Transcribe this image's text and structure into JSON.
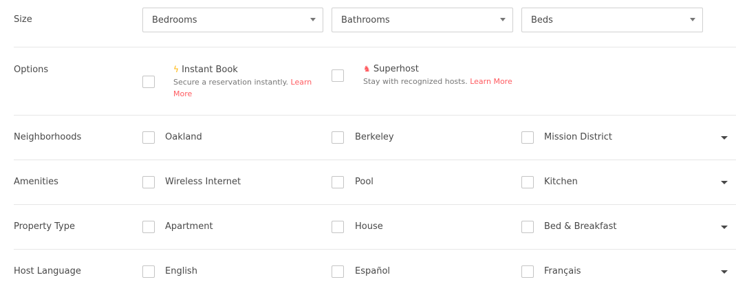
{
  "size": {
    "label": "Size",
    "selects": [
      {
        "value": "Bedrooms"
      },
      {
        "value": "Bathrooms"
      },
      {
        "value": "Beds"
      }
    ]
  },
  "options": {
    "label": "Options",
    "instant_book": {
      "icon": "lightning-icon",
      "title": "Instant Book",
      "description": "Secure a reservation instantly.",
      "link": "Learn More"
    },
    "superhost": {
      "icon": "trophy-icon",
      "title": "Superhost",
      "description": "Stay with recognized hosts.",
      "link": "Learn More"
    }
  },
  "filters": [
    {
      "label": "Neighborhoods",
      "options": [
        "Oakland",
        "Berkeley",
        "Mission District"
      ]
    },
    {
      "label": "Amenities",
      "options": [
        "Wireless Internet",
        "Pool",
        "Kitchen"
      ]
    },
    {
      "label": "Property Type",
      "options": [
        "Apartment",
        "House",
        "Bed & Breakfast"
      ]
    },
    {
      "label": "Host Language",
      "options": [
        "English",
        "Español",
        "Français"
      ]
    }
  ],
  "colors": {
    "accent_link": "#ff5a5f",
    "text": "#484848",
    "muted": "#767676",
    "divider": "#e6e6e6"
  }
}
